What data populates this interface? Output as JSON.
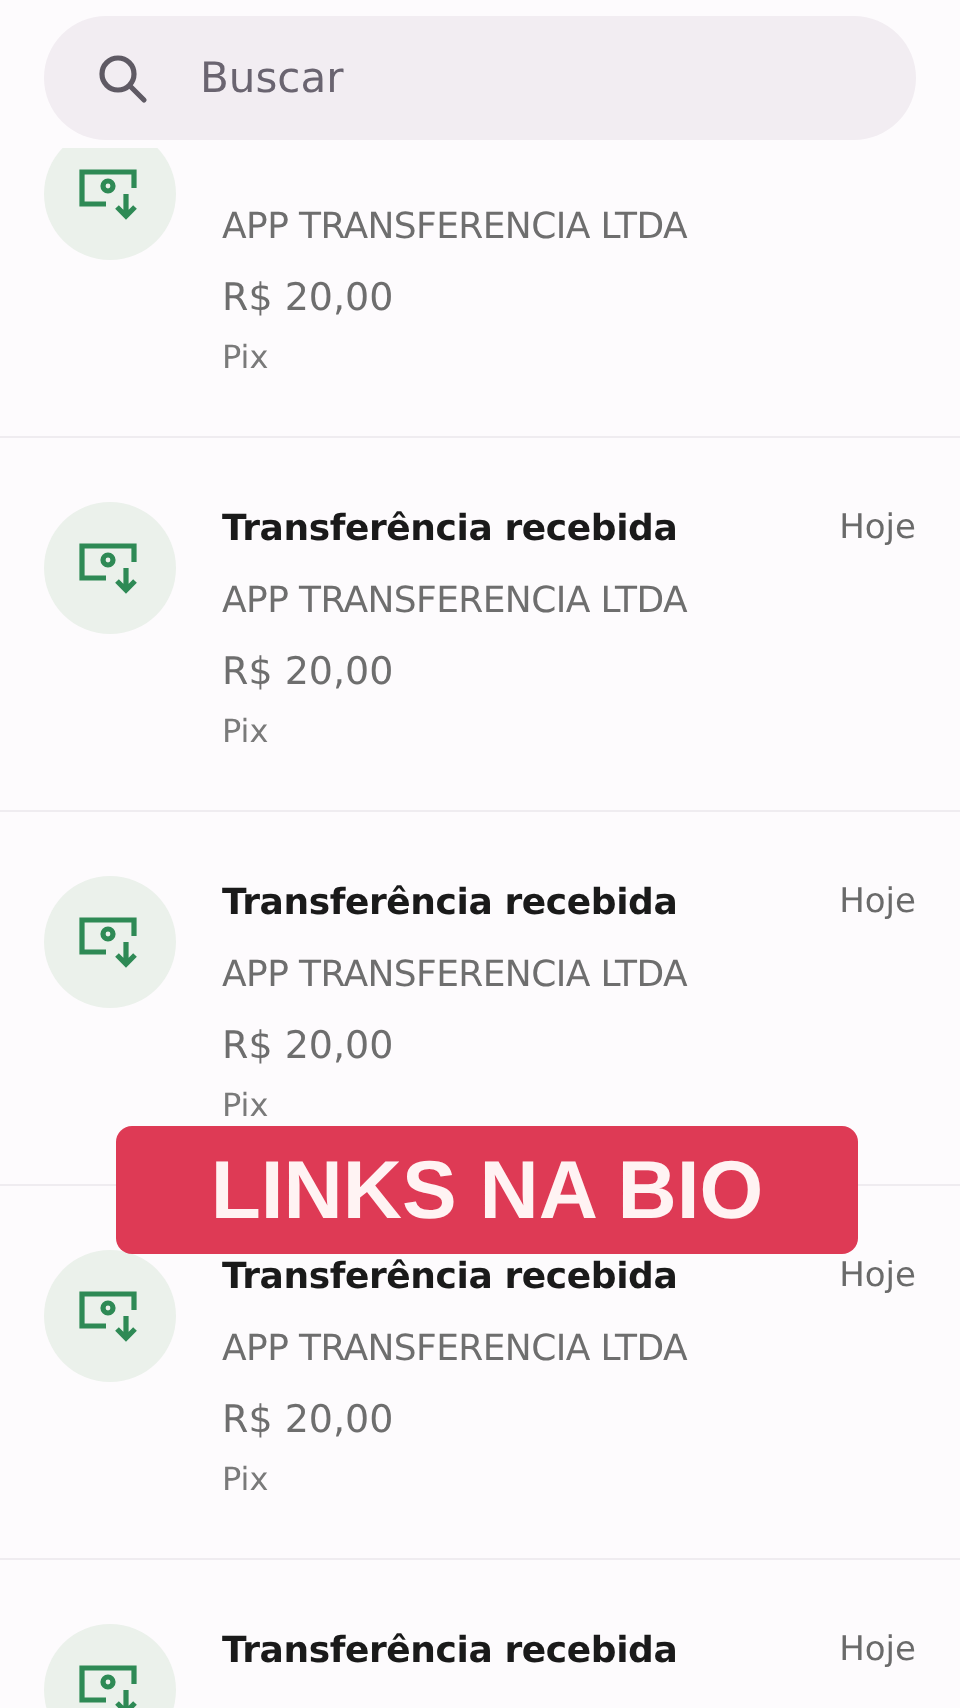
{
  "search": {
    "placeholder": "Buscar"
  },
  "transactions": [
    {
      "subtitle": "APP TRANSFERENCIA LTDA",
      "amount": "R$ 20,00",
      "method": "Pix"
    },
    {
      "title": "Transferência recebida",
      "date": "Hoje",
      "subtitle": "APP TRANSFERENCIA LTDA",
      "amount": "R$ 20,00",
      "method": "Pix"
    },
    {
      "title": "Transferência recebida",
      "date": "Hoje",
      "subtitle": "APP TRANSFERENCIA LTDA",
      "amount": "R$ 20,00",
      "method": "Pix"
    },
    {
      "title": "Transferência recebida",
      "date": "Hoje",
      "subtitle": "APP TRANSFERENCIA LTDA",
      "amount": "R$ 20,00",
      "method": "Pix"
    },
    {
      "title": "Transferência recebida",
      "date": "Hoje"
    }
  ],
  "overlay_banner": {
    "text": "LINKS NA BIO"
  }
}
